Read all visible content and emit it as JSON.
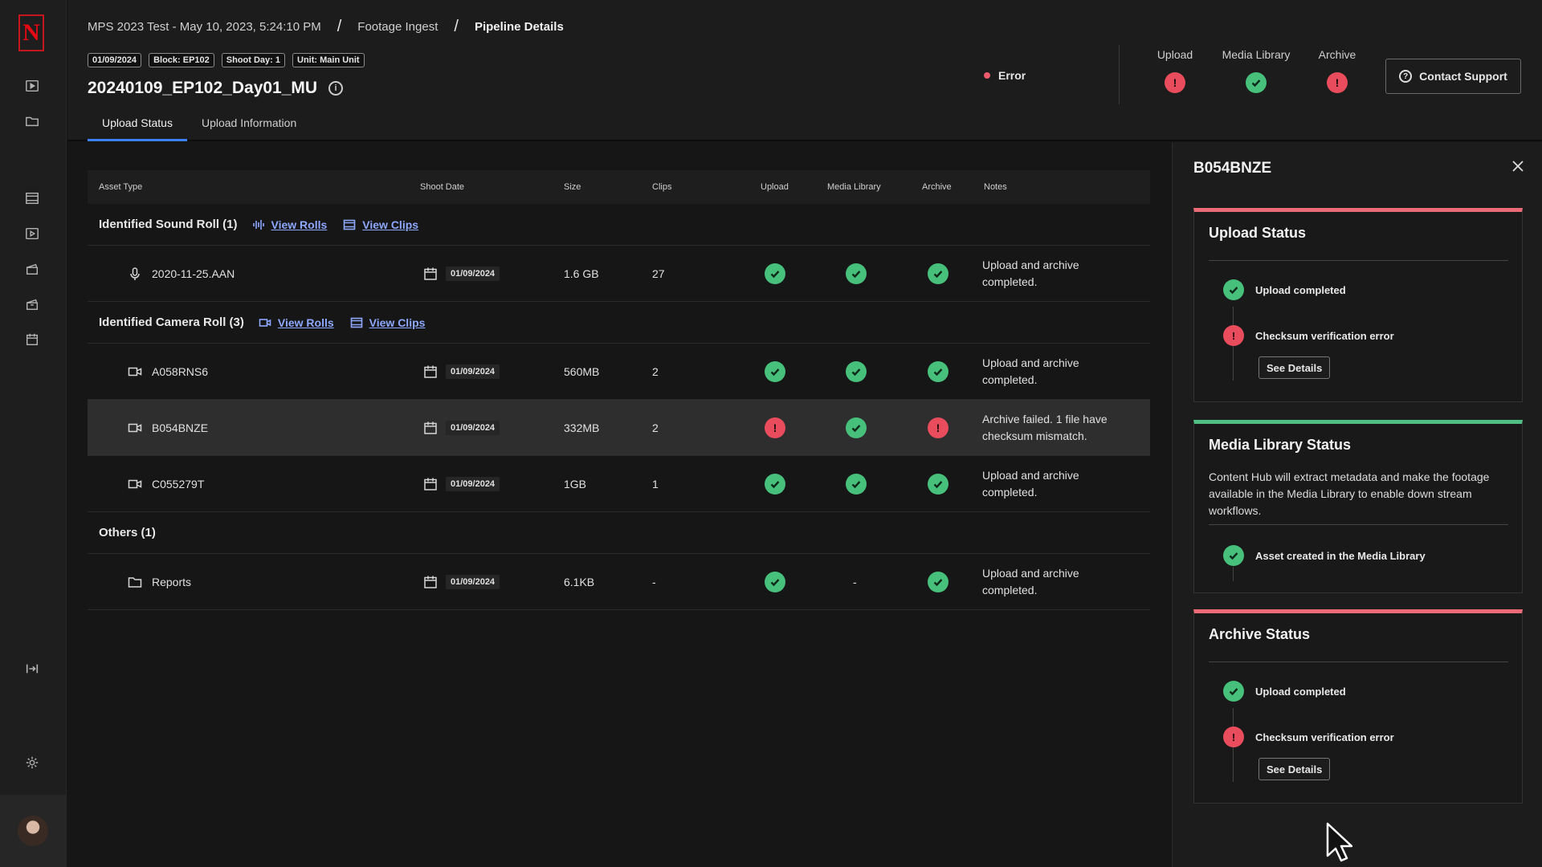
{
  "breadcrumb": {
    "items": [
      "MPS 2023 Test - May 10, 2023, 5:24:10 PM",
      "Footage Ingest",
      "Pipeline Details"
    ],
    "separator": "/"
  },
  "tags": [
    "01/09/2024",
    "Block: EP102",
    "Shoot Day: 1",
    "Unit: Main Unit"
  ],
  "page_title": "20240109_EP102_Day01_MU",
  "info_glyph": "i",
  "tabs": [
    "Upload Status",
    "Upload Information"
  ],
  "overall_status": "Error",
  "status_columns": [
    {
      "label": "Upload",
      "status": "error"
    },
    {
      "label": "Media Library",
      "status": "ok"
    },
    {
      "label": "Archive",
      "status": "error"
    }
  ],
  "contact_support": "Contact Support",
  "table": {
    "headers": [
      "Asset Type",
      "Shoot Date",
      "Size",
      "Clips",
      "Upload",
      "Media Library",
      "Archive",
      "Notes"
    ],
    "groups": [
      {
        "title": "Identified Sound Roll (1)",
        "view_rolls": "View Rolls",
        "view_clips": "View Clips",
        "rows": [
          {
            "icon": "microphone-icon",
            "name": "2020-11-25.AAN",
            "date": "01/09/2024",
            "size": "1.6 GB",
            "clips": "27",
            "upload": "ok",
            "media": "ok",
            "archive": "ok",
            "notes": "Upload and archive completed."
          }
        ]
      },
      {
        "title": "Identified Camera Roll (3)",
        "view_rolls": "View Rolls",
        "view_clips": "View Clips",
        "rows": [
          {
            "icon": "video-camera-icon",
            "name": "A058RNS6",
            "date": "01/09/2024",
            "size": "560MB",
            "clips": "2",
            "upload": "ok",
            "media": "ok",
            "archive": "ok",
            "notes": "Upload and archive completed."
          },
          {
            "icon": "video-camera-icon",
            "name": "B054BNZE",
            "date": "01/09/2024",
            "size": "332MB",
            "clips": "2",
            "upload": "error",
            "media": "ok",
            "archive": "error",
            "notes": "Archive failed. 1 file have checksum mismatch."
          },
          {
            "icon": "video-camera-icon",
            "name": "C055279T",
            "date": "01/09/2024",
            "size": "1GB",
            "clips": "1",
            "upload": "ok",
            "media": "ok",
            "archive": "ok",
            "notes": "Upload and archive completed."
          }
        ]
      },
      {
        "title": "Others (1)",
        "rows": [
          {
            "icon": "folder-icon",
            "name": "Reports",
            "date": "01/09/2024",
            "size": "6.1KB",
            "clips": "-",
            "upload": "ok",
            "media": "-",
            "archive": "ok",
            "notes": "Upload and archive completed."
          }
        ]
      }
    ]
  },
  "panel": {
    "title": "B054BNZE",
    "upload_status": {
      "title": "Upload Status",
      "item1": "Upload completed",
      "item2": "Checksum verification error",
      "button": "See Details"
    },
    "media_status": {
      "title": "Media Library Status",
      "description": "Content Hub will extract metadata and make the footage available in the Media Library to enable down stream workflows.",
      "item1": "Asset created in the Media Library"
    },
    "archive_status": {
      "title": "Archive Status",
      "item1": "Upload completed",
      "item2": "Checksum verification error",
      "button": "See Details"
    }
  },
  "colors": {
    "ok": "#46c07a",
    "error": "#e84c5d",
    "link": "#8ea8ff",
    "tab_underline": "#3b82f6",
    "brand": "#e50914"
  }
}
